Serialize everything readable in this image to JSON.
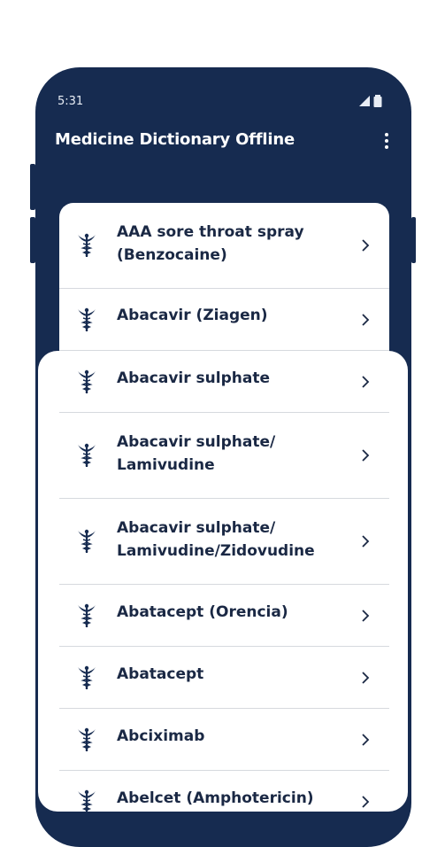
{
  "status_bar": {
    "time": "5:31"
  },
  "app_bar": {
    "title": "Medicine Dictionary Offline"
  },
  "medicines": [
    {
      "name": "AAA sore throat spray (Benzocaine)"
    },
    {
      "name": "Abacavir (Ziagen)"
    },
    {
      "name": "Abacavir sulphate"
    },
    {
      "name": "Abacavir sulphate/ Lamivudine"
    },
    {
      "name": "Abacavir sulphate/ Lamivudine/Zidovudine"
    },
    {
      "name": "Abatacept (Orencia)"
    },
    {
      "name": "Abatacept"
    },
    {
      "name": "Abciximab"
    },
    {
      "name": "Abelcet (Amphotericin)"
    }
  ],
  "icons": {
    "item": "caduceus-icon",
    "arrow": "chevron-right-icon",
    "menu": "more-vert-icon"
  },
  "colors": {
    "primary": "#162b50",
    "text": "#1a2844",
    "divider": "#d6d9de"
  }
}
